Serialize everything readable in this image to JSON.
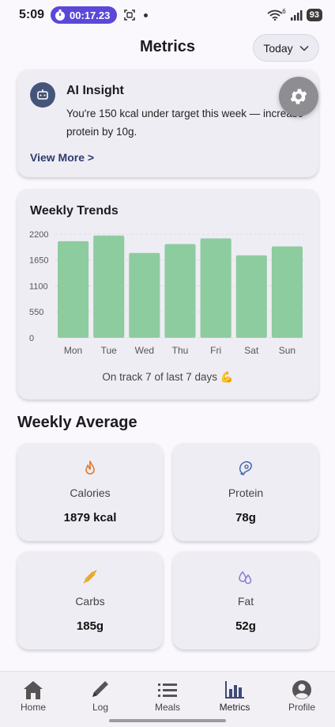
{
  "status_bar": {
    "time": "5:09",
    "timer": "00:17.23",
    "battery": "93",
    "signal_sup": "6"
  },
  "header": {
    "title": "Metrics",
    "range_label": "Today"
  },
  "insight": {
    "title": "AI Insight",
    "text": "You're 150 kcal under target this week — increase protein by 10g.",
    "link": "View More >"
  },
  "trends": {
    "title": "Weekly Trends",
    "footer": "On track 7 of last 7 days 💪"
  },
  "chart_data": {
    "type": "bar",
    "title": "Weekly Trends",
    "categories": [
      "Mon",
      "Tue",
      "Wed",
      "Thu",
      "Fri",
      "Sat",
      "Sun"
    ],
    "values": [
      2050,
      2170,
      1800,
      1990,
      2110,
      1750,
      1940
    ],
    "yticks": [
      0,
      550,
      1100,
      1650,
      2200
    ],
    "ylim": [
      0,
      2250
    ],
    "bar_color": "#8dcc9f",
    "grid": true
  },
  "averages": {
    "title": "Weekly Average",
    "cards": [
      {
        "label": "Calories",
        "value": "1879 kcal",
        "icon": "flame-icon",
        "color": "#e0782d"
      },
      {
        "label": "Protein",
        "value": "78g",
        "icon": "meat-icon",
        "color": "#4a6fae"
      },
      {
        "label": "Carbs",
        "value": "185g",
        "icon": "wheat-icon",
        "color": "#e3a72a"
      },
      {
        "label": "Fat",
        "value": "52g",
        "icon": "droplets-icon",
        "color": "#8a80d6"
      }
    ]
  },
  "nav": {
    "items": [
      {
        "label": "Home"
      },
      {
        "label": "Log"
      },
      {
        "label": "Meals"
      },
      {
        "label": "Metrics"
      },
      {
        "label": "Profile"
      }
    ]
  },
  "colors": {
    "accent": "#5b48d9",
    "bar": "#8dcc9f",
    "nav_active": "#3d4a7a"
  }
}
